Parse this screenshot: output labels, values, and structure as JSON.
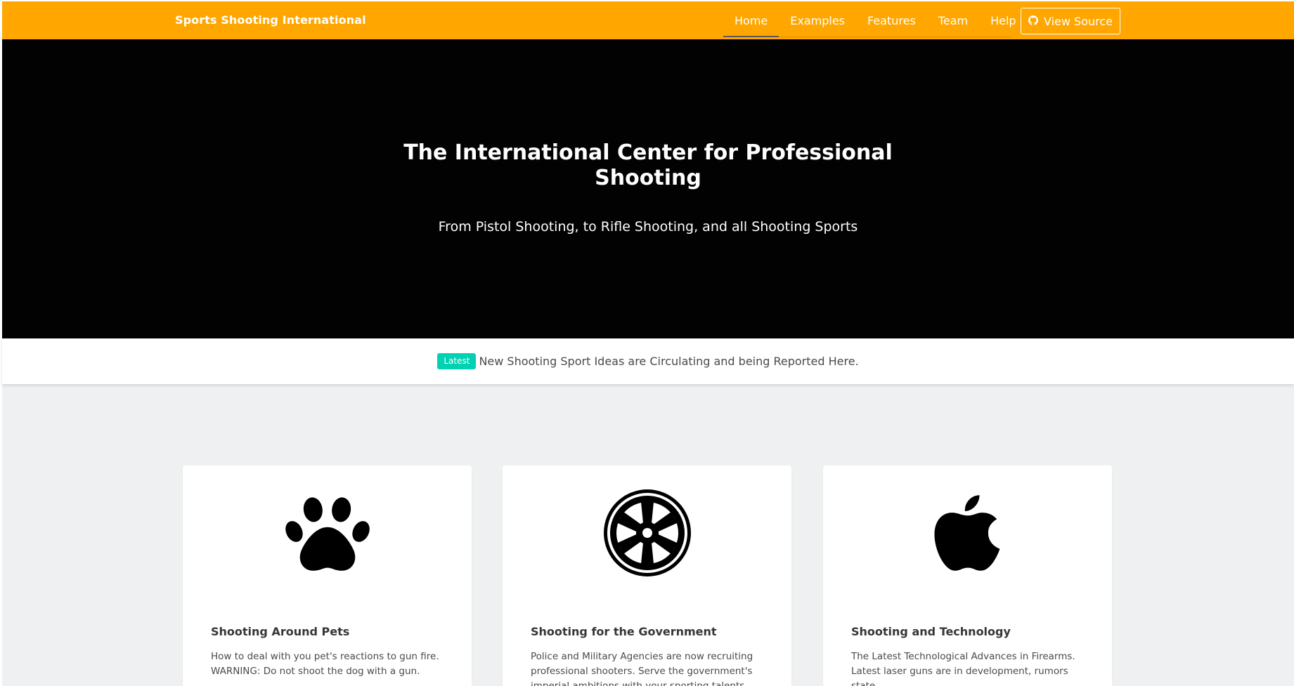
{
  "navbar": {
    "brand": "Sports Shooting International",
    "tabs": [
      {
        "label": "Home",
        "active": true
      },
      {
        "label": "Examples",
        "active": false
      },
      {
        "label": "Features",
        "active": false
      },
      {
        "label": "Team",
        "active": false
      },
      {
        "label": "Help",
        "active": false
      }
    ],
    "source_button": {
      "label": "View Source",
      "icon": "github-icon"
    },
    "bg_color": "#ffa700"
  },
  "hero": {
    "title_line1": "The International Center for Professional",
    "title_line2": "Shooting",
    "subtitle": "From Pistol Shooting, to Rifle Shooting, and all Shooting Sports",
    "bg_color": "#020202"
  },
  "announcement": {
    "badge": "Latest",
    "text": "New Shooting Sport Ideas are Circulating and being Reported Here.",
    "badge_color": "#00d1b2"
  },
  "cards": [
    {
      "icon": "paw-icon",
      "title": "Shooting Around Pets",
      "text": "How to deal with you pet's reactions to gun fire. WARNING: Do not shoot the dog with a gun."
    },
    {
      "icon": "galactic-empire-icon",
      "title": "Shooting for the Government",
      "text": "Police and Military Agencies are now recruiting professional shooters. Serve the government's imperial ambitions with your sporting talents."
    },
    {
      "icon": "apple-icon",
      "title": "Shooting and Technology",
      "text": "The Latest Technological Advances in Firearms. Latest laser guns are in development, rumors state."
    }
  ]
}
